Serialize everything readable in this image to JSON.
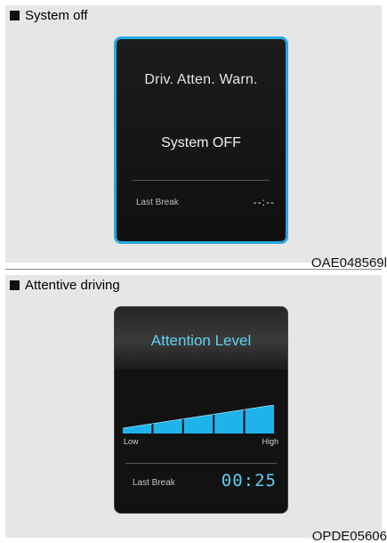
{
  "panel_top": {
    "heading": "System off",
    "code": "OAE048569l",
    "screen": {
      "title": "Driv. Atten. Warn.",
      "status": "System OFF",
      "last_break_label": "Last Break",
      "last_break_value": "--:--"
    }
  },
  "panel_bottom": {
    "heading": "Attentive driving",
    "code": "OPDE05606",
    "screen": {
      "title": "Attention Level",
      "gauge": {
        "low_label": "Low",
        "high_label": "High",
        "segments_total": 5,
        "segments_filled": 5
      },
      "last_break_label": "Last Break",
      "last_break_value": "00:25"
    }
  },
  "colors": {
    "screen_border_active": "#27a9e1",
    "accent_cyan": "#5fd0f2",
    "gauge_fill": "#1fb3ea",
    "panel_background": "#e6e6e6"
  }
}
